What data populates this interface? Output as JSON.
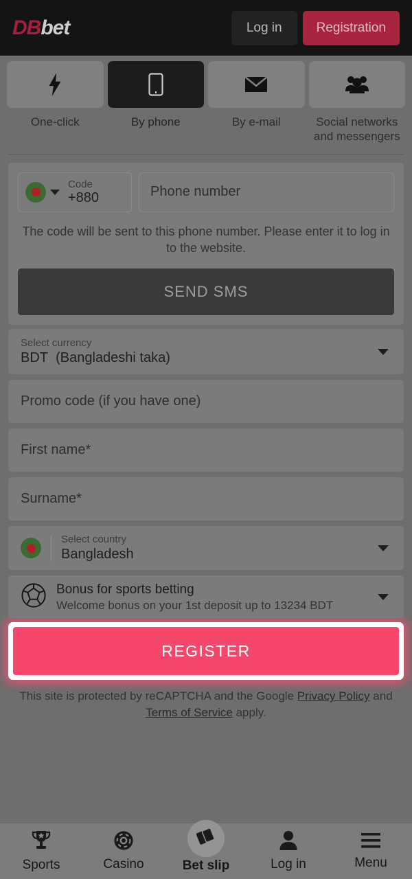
{
  "header": {
    "logo_db": "DB",
    "logo_bet": "bet",
    "login_label": "Log in",
    "registration_label": "Registration",
    "background_color": "#141414",
    "registration_color": "#a8253f"
  },
  "tabs": [
    {
      "label": "One-click",
      "icon": "lightning-bolt-icon",
      "active": false
    },
    {
      "label": "By phone",
      "icon": "mobile-phone-icon",
      "active": true
    },
    {
      "label": "By e-mail",
      "icon": "envelope-icon",
      "active": false
    },
    {
      "label": "Social networks and messengers",
      "icon": "people-group-icon",
      "active": false
    }
  ],
  "phone_section": {
    "code_label": "Code",
    "code_value": "+880",
    "flag": "bangladesh-flag-icon",
    "phone_placeholder": "Phone number",
    "hint": "The code will be sent to this phone number. Please enter it to log in to the website.",
    "send_sms_label": "SEND SMS"
  },
  "currency": {
    "label": "Select currency",
    "code": "BDT",
    "name": "(Bangladeshi taka)"
  },
  "promo": {
    "placeholder": "Promo code (if you have one)"
  },
  "first_name": {
    "placeholder": "First name*"
  },
  "surname": {
    "placeholder": "Surname*"
  },
  "country": {
    "label": "Select country",
    "value": "Bangladesh",
    "flag": "bangladesh-flag-icon"
  },
  "bonus": {
    "icon": "soccer-ball-icon",
    "title": "Bonus for sports betting",
    "description": "Welcome bonus on your 1st deposit up to 13234 BDT"
  },
  "register": {
    "label": "REGISTER",
    "color": "#f4476b",
    "highlighted": true
  },
  "recaptcha": {
    "text_before": "This site is protected by reCAPTCHA and the Google ",
    "privacy_link": "Privacy Policy",
    "text_middle": " and ",
    "terms_link": "Terms of Service",
    "text_after": " apply."
  },
  "bottom_nav": [
    {
      "label": "Sports",
      "icon": "trophy-icon"
    },
    {
      "label": "Casino",
      "icon": "casino-chip-icon"
    },
    {
      "label": "Bet slip",
      "icon": "bet-slip-cards-icon"
    },
    {
      "label": "Log in",
      "icon": "user-person-icon"
    },
    {
      "label": "Menu",
      "icon": "hamburger-menu-icon"
    }
  ]
}
